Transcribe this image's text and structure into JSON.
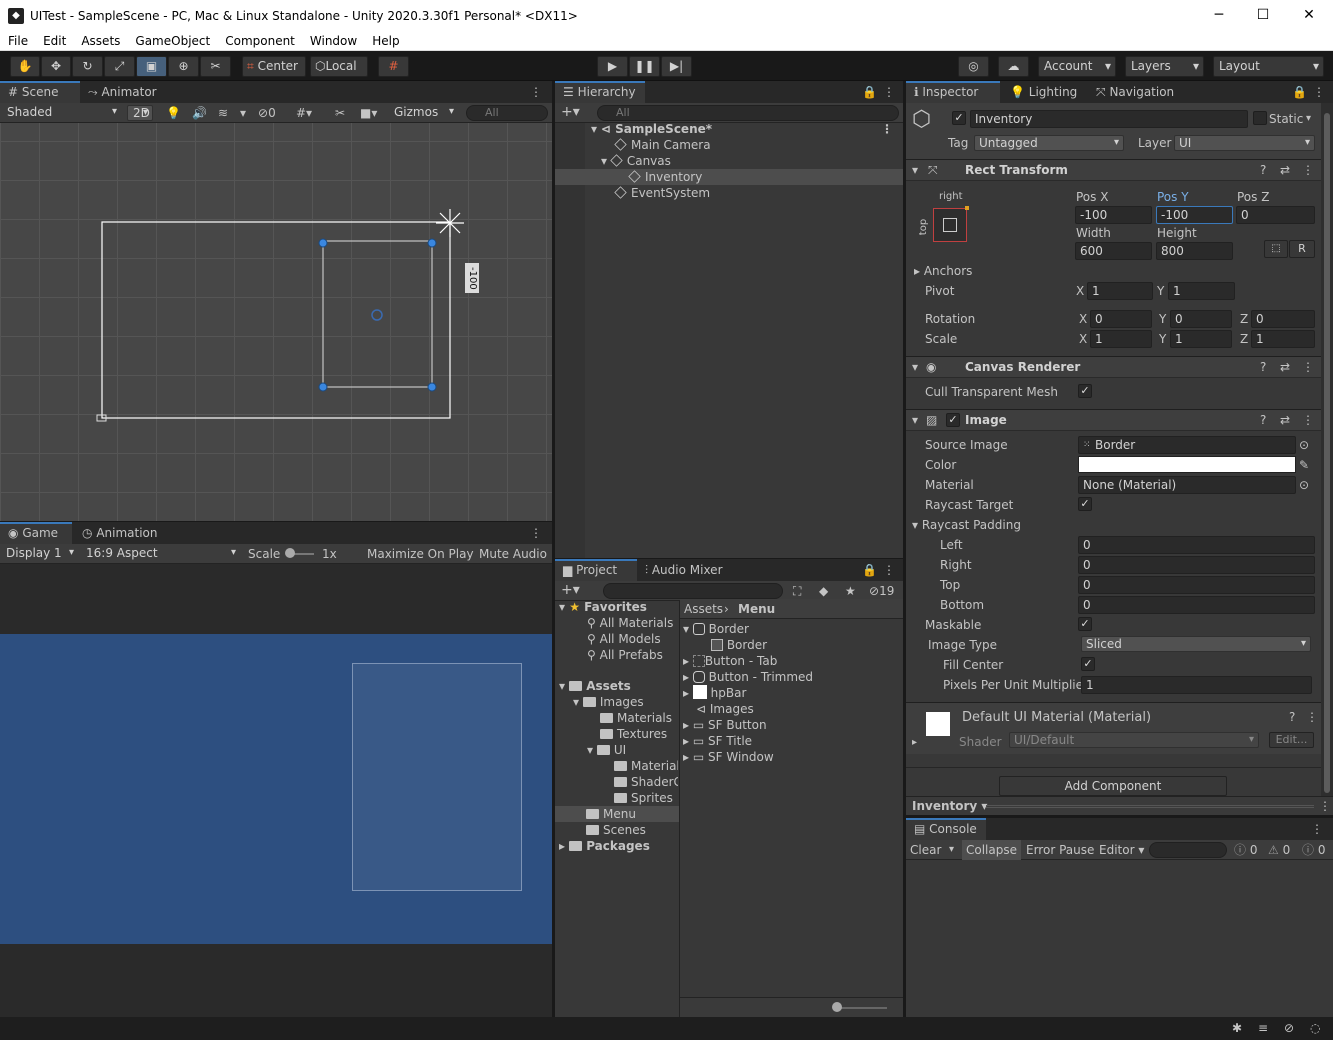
{
  "window": {
    "title": "UITest - SampleScene - PC, Mac & Linux Standalone - Unity 2020.3.30f1 Personal* <DX11>",
    "minimize": "─",
    "maximize": "☐",
    "close": "✕"
  },
  "menu": [
    "File",
    "Edit",
    "Assets",
    "GameObject",
    "Component",
    "Window",
    "Help"
  ],
  "toolbar": {
    "center": "Center",
    "local": "Local",
    "account": "Account",
    "layers": "Layers",
    "layout": "Layout"
  },
  "scene": {
    "tab_scene": "Scene",
    "tab_animator": "Animator",
    "shading": "Shaded",
    "mode_2d": "2D",
    "hidden_count": "0",
    "gizmos": "Gizmos",
    "search_placeholder": "All",
    "pos_label": "-100"
  },
  "game": {
    "tab_game": "Game",
    "tab_animation": "Animation",
    "display": "Display 1",
    "aspect": "16:9 Aspect",
    "scale_label": "Scale",
    "scale_value": "1x",
    "maximize": "Maximize On Play",
    "mute": "Mute Audio",
    "bg_color": "#2d4f80"
  },
  "hierarchy": {
    "tab": "Hierarchy",
    "search_placeholder": "All",
    "items": [
      {
        "label": "SampleScene*",
        "indent": 0
      },
      {
        "label": "Main Camera",
        "indent": 1
      },
      {
        "label": "Canvas",
        "indent": 1
      },
      {
        "label": "Inventory",
        "indent": 2
      },
      {
        "label": "EventSystem",
        "indent": 1
      }
    ]
  },
  "project": {
    "tab_project": "Project",
    "tab_audio": "Audio Mixer",
    "hidden_count": "19",
    "favorites_label": "Favorites",
    "favorites": [
      "All Materials",
      "All Models",
      "All Prefabs"
    ],
    "assets_label": "Assets",
    "tree": [
      "Images",
      "Materials",
      "Textures",
      "UI",
      "Materials",
      "ShaderG",
      "Sprites",
      "Menu",
      "Scenes"
    ],
    "packages_label": "Packages",
    "breadcrumb_root": "Assets",
    "breadcrumb_current": "Menu",
    "files": [
      "Border",
      "Border",
      "Button - Tab",
      "Button - Trimmed",
      "hpBar",
      "Images",
      "SF Button",
      "SF Title",
      "SF Window"
    ]
  },
  "inspector": {
    "tab_inspector": "Inspector",
    "tab_lighting": "Lighting",
    "tab_navigation": "Navigation",
    "object_name": "Inventory",
    "static_label": "Static",
    "tag_label": "Tag",
    "tag_value": "Untagged",
    "layer_label": "Layer",
    "layer_value": "UI",
    "rect_transform": {
      "title": "Rect Transform",
      "anchor_h": "right",
      "anchor_v": "top",
      "posx_label": "Pos X",
      "posy_label": "Pos Y",
      "posz_label": "Pos Z",
      "posx": "-100",
      "posy": "-100",
      "posz": "0",
      "width_label": "Width",
      "height_label": "Height",
      "width": "600",
      "height": "800",
      "r_label": "R",
      "anchors_label": "Anchors",
      "pivot_label": "Pivot",
      "pivot_x": "1",
      "pivot_y": "1",
      "rotation_label": "Rotation",
      "rot_x": "0",
      "rot_y": "0",
      "rot_z": "0",
      "scale_label": "Scale",
      "scale_x": "1",
      "scale_y": "1",
      "scale_z": "1",
      "x": "X",
      "y": "Y",
      "z": "Z"
    },
    "canvas_renderer": {
      "title": "Canvas Renderer",
      "cull_label": "Cull Transparent Mesh"
    },
    "image": {
      "title": "Image",
      "source_label": "Source Image",
      "source_value": "Border",
      "color_label": "Color",
      "material_label": "Material",
      "material_value": "None (Material)",
      "raycast_target": "Raycast Target",
      "raycast_padding": "Raycast Padding",
      "left": "Left",
      "right": "Right",
      "top": "Top",
      "bottom": "Bottom",
      "left_v": "0",
      "right_v": "0",
      "top_v": "0",
      "bottom_v": "0",
      "maskable": "Maskable",
      "image_type_label": "Image Type",
      "image_type": "Sliced",
      "fill_center": "Fill Center",
      "ppu_label": "Pixels Per Unit Multiplier",
      "ppu_value": "1"
    },
    "material": {
      "title": "Default UI Material (Material)",
      "shader_label": "Shader",
      "shader_value": "UI/Default",
      "edit": "Edit..."
    },
    "add_component": "Add Component",
    "footer_name": "Inventory"
  },
  "console": {
    "tab": "Console",
    "clear": "Clear",
    "collapse": "Collapse",
    "error_pause": "Error Pause",
    "editor": "Editor",
    "info": "0",
    "warn": "0",
    "error": "0"
  },
  "accent": "#3a79bb"
}
